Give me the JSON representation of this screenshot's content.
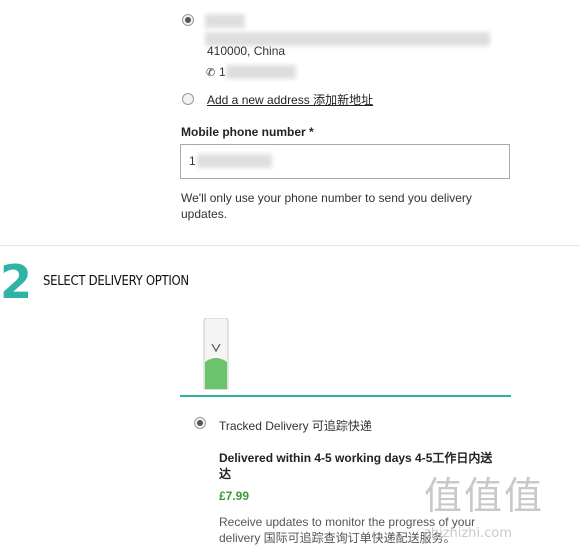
{
  "address": {
    "line_city": "410000, China",
    "phone_prefix": "1",
    "add_new_label": "Add a new address 添加新地址"
  },
  "mobile": {
    "label": "Mobile phone number *",
    "value": "1",
    "note": "We'll only use your phone number to send you delivery updates."
  },
  "step2": {
    "number": "2",
    "title": "SELECT DELIVERY OPTION"
  },
  "delivery": {
    "option_label": "Tracked Delivery 可追踪快递",
    "window": "Delivered within 4-5 working days 4-5工作日内送达",
    "price": "£7.99",
    "description": "Receive updates to monitor the progress of your delivery 国际可追踪查询订单快递配送服务。"
  },
  "watermark": {
    "line1": "值值值",
    "line2": "zhizhizhi.com"
  }
}
